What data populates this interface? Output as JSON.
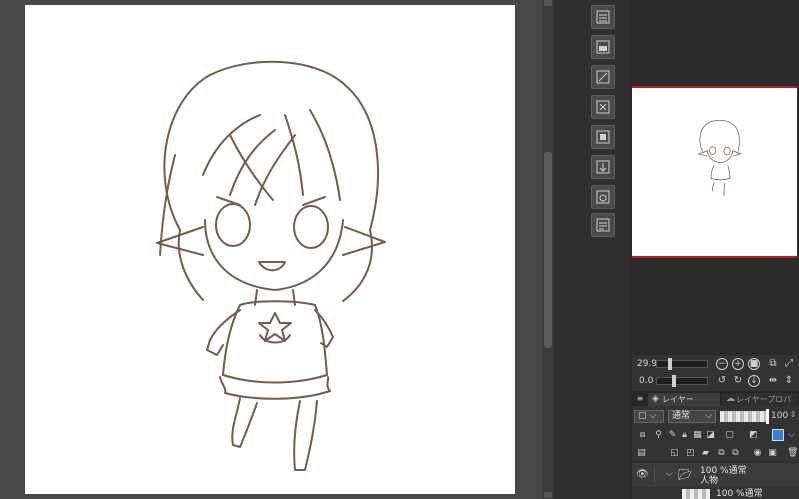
{
  "navigator": {
    "zoom_value": "29.9",
    "rotation_value": "0.0"
  },
  "panel_tabs": {
    "layer": "レイヤー",
    "layer_property": "レイヤープロパティ"
  },
  "layer_toolbar": {
    "blend_mode": "通常",
    "opacity": "100"
  },
  "layers": [
    {
      "opacity_mode": "100 %通常",
      "name": "人物"
    },
    {
      "opacity_mode": "100 %通常",
      "name": ""
    }
  ],
  "colors": {
    "line_art": "#7a5a4a",
    "navigator_border": "#c21d1d",
    "canvas_bg": "#ffffff",
    "workspace_bg": "#474747"
  },
  "icons": {
    "palette": [
      "layer-icon",
      "layer-folder-icon",
      "vector-layer-icon",
      "transform-icon",
      "layer-mask-icon",
      "merge-layer-icon",
      "camera-icon",
      "reference-layer-icon"
    ]
  }
}
